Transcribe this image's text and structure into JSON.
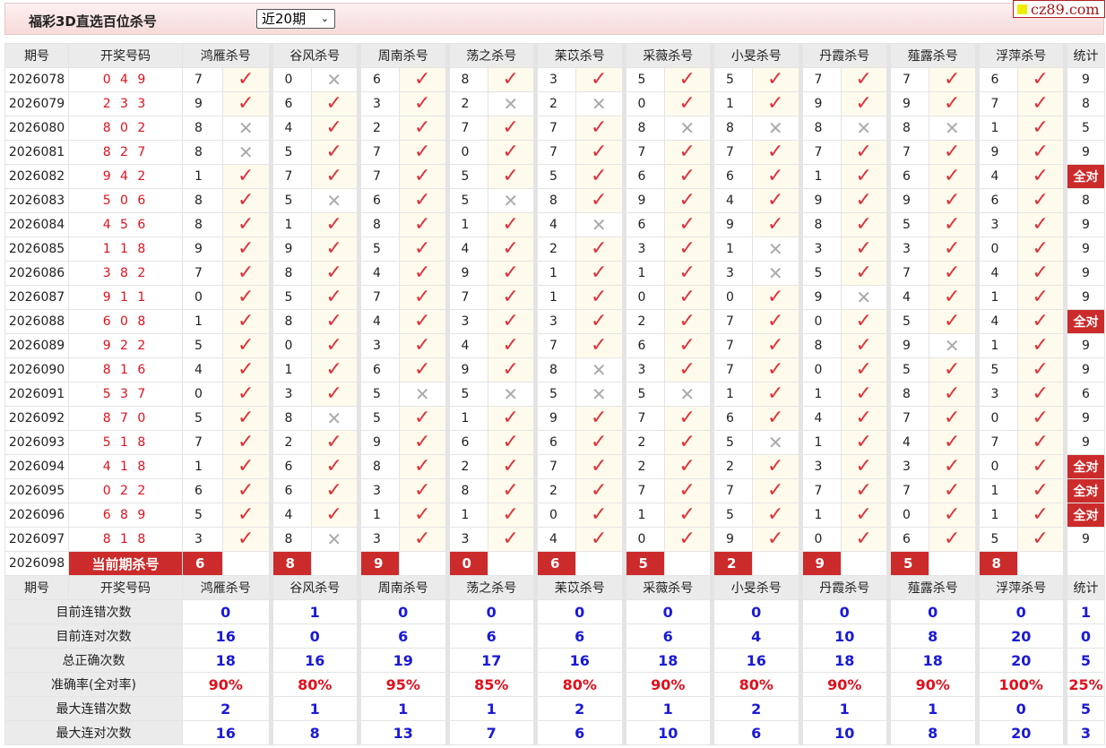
{
  "header": {
    "title": "福彩3D直选百位杀号",
    "period_select": "近20期",
    "logo": "cz89.com"
  },
  "columns": {
    "issue": "期号",
    "draw": "开奖号码",
    "stat": "统计",
    "predictors": [
      "鸿雁杀号",
      "谷风杀号",
      "周南杀号",
      "荡之杀号",
      "苿苡杀号",
      "采薇杀号",
      "小旻杀号",
      "丹霞杀号",
      "薤露杀号",
      "浮萍杀号"
    ]
  },
  "rows": [
    {
      "issue": "2026078",
      "draw": "0 4 9",
      "picks": [
        [
          7,
          1
        ],
        [
          0,
          0
        ],
        [
          6,
          1
        ],
        [
          8,
          1
        ],
        [
          3,
          1
        ],
        [
          5,
          1
        ],
        [
          5,
          1
        ],
        [
          7,
          1
        ],
        [
          7,
          1
        ],
        [
          6,
          1
        ]
      ],
      "stat": "9"
    },
    {
      "issue": "2026079",
      "draw": "2 3 3",
      "picks": [
        [
          9,
          1
        ],
        [
          6,
          1
        ],
        [
          3,
          1
        ],
        [
          2,
          0
        ],
        [
          2,
          0
        ],
        [
          0,
          1
        ],
        [
          1,
          1
        ],
        [
          9,
          1
        ],
        [
          9,
          1
        ],
        [
          7,
          1
        ]
      ],
      "stat": "8"
    },
    {
      "issue": "2026080",
      "draw": "8 0 2",
      "picks": [
        [
          8,
          0
        ],
        [
          4,
          1
        ],
        [
          2,
          1
        ],
        [
          7,
          1
        ],
        [
          7,
          1
        ],
        [
          8,
          0
        ],
        [
          8,
          0
        ],
        [
          8,
          0
        ],
        [
          8,
          0
        ],
        [
          1,
          1
        ]
      ],
      "stat": "5"
    },
    {
      "issue": "2026081",
      "draw": "8 2 7",
      "picks": [
        [
          8,
          0
        ],
        [
          5,
          1
        ],
        [
          7,
          1
        ],
        [
          0,
          1
        ],
        [
          7,
          1
        ],
        [
          7,
          1
        ],
        [
          7,
          1
        ],
        [
          7,
          1
        ],
        [
          7,
          1
        ],
        [
          9,
          1
        ]
      ],
      "stat": "9"
    },
    {
      "issue": "2026082",
      "draw": "9 4 2",
      "picks": [
        [
          1,
          1
        ],
        [
          7,
          1
        ],
        [
          7,
          1
        ],
        [
          5,
          1
        ],
        [
          5,
          1
        ],
        [
          6,
          1
        ],
        [
          6,
          1
        ],
        [
          1,
          1
        ],
        [
          6,
          1
        ],
        [
          4,
          1
        ]
      ],
      "stat": "全对"
    },
    {
      "issue": "2026083",
      "draw": "5 0 6",
      "picks": [
        [
          8,
          1
        ],
        [
          5,
          0
        ],
        [
          6,
          1
        ],
        [
          5,
          0
        ],
        [
          8,
          1
        ],
        [
          9,
          1
        ],
        [
          4,
          1
        ],
        [
          9,
          1
        ],
        [
          9,
          1
        ],
        [
          6,
          1
        ]
      ],
      "stat": "8"
    },
    {
      "issue": "2026084",
      "draw": "4 5 6",
      "picks": [
        [
          8,
          1
        ],
        [
          1,
          1
        ],
        [
          8,
          1
        ],
        [
          1,
          1
        ],
        [
          4,
          0
        ],
        [
          6,
          1
        ],
        [
          9,
          1
        ],
        [
          8,
          1
        ],
        [
          5,
          1
        ],
        [
          3,
          1
        ]
      ],
      "stat": "9"
    },
    {
      "issue": "2026085",
      "draw": "1 1 8",
      "picks": [
        [
          9,
          1
        ],
        [
          9,
          1
        ],
        [
          5,
          1
        ],
        [
          4,
          1
        ],
        [
          2,
          1
        ],
        [
          3,
          1
        ],
        [
          1,
          0
        ],
        [
          3,
          1
        ],
        [
          3,
          1
        ],
        [
          0,
          1
        ]
      ],
      "stat": "9"
    },
    {
      "issue": "2026086",
      "draw": "3 8 2",
      "picks": [
        [
          7,
          1
        ],
        [
          8,
          1
        ],
        [
          4,
          1
        ],
        [
          9,
          1
        ],
        [
          1,
          1
        ],
        [
          1,
          1
        ],
        [
          3,
          0
        ],
        [
          5,
          1
        ],
        [
          7,
          1
        ],
        [
          4,
          1
        ]
      ],
      "stat": "9"
    },
    {
      "issue": "2026087",
      "draw": "9 1 1",
      "picks": [
        [
          0,
          1
        ],
        [
          5,
          1
        ],
        [
          7,
          1
        ],
        [
          7,
          1
        ],
        [
          1,
          1
        ],
        [
          0,
          1
        ],
        [
          0,
          1
        ],
        [
          9,
          0
        ],
        [
          4,
          1
        ],
        [
          1,
          1
        ]
      ],
      "stat": "9"
    },
    {
      "issue": "2026088",
      "draw": "6 0 8",
      "picks": [
        [
          1,
          1
        ],
        [
          8,
          1
        ],
        [
          4,
          1
        ],
        [
          3,
          1
        ],
        [
          3,
          1
        ],
        [
          2,
          1
        ],
        [
          7,
          1
        ],
        [
          0,
          1
        ],
        [
          5,
          1
        ],
        [
          4,
          1
        ]
      ],
      "stat": "全对"
    },
    {
      "issue": "2026089",
      "draw": "9 2 2",
      "picks": [
        [
          5,
          1
        ],
        [
          0,
          1
        ],
        [
          3,
          1
        ],
        [
          4,
          1
        ],
        [
          7,
          1
        ],
        [
          6,
          1
        ],
        [
          7,
          1
        ],
        [
          8,
          1
        ],
        [
          9,
          0
        ],
        [
          1,
          1
        ]
      ],
      "stat": "9"
    },
    {
      "issue": "2026090",
      "draw": "8 1 6",
      "picks": [
        [
          4,
          1
        ],
        [
          1,
          1
        ],
        [
          6,
          1
        ],
        [
          9,
          1
        ],
        [
          8,
          0
        ],
        [
          3,
          1
        ],
        [
          7,
          1
        ],
        [
          0,
          1
        ],
        [
          5,
          1
        ],
        [
          5,
          1
        ]
      ],
      "stat": "9"
    },
    {
      "issue": "2026091",
      "draw": "5 3 7",
      "picks": [
        [
          0,
          1
        ],
        [
          3,
          1
        ],
        [
          5,
          0
        ],
        [
          5,
          0
        ],
        [
          5,
          0
        ],
        [
          5,
          0
        ],
        [
          1,
          1
        ],
        [
          1,
          1
        ],
        [
          8,
          1
        ],
        [
          3,
          1
        ]
      ],
      "stat": "6"
    },
    {
      "issue": "2026092",
      "draw": "8 7 0",
      "picks": [
        [
          5,
          1
        ],
        [
          8,
          0
        ],
        [
          5,
          1
        ],
        [
          1,
          1
        ],
        [
          9,
          1
        ],
        [
          7,
          1
        ],
        [
          6,
          1
        ],
        [
          4,
          1
        ],
        [
          7,
          1
        ],
        [
          0,
          1
        ]
      ],
      "stat": "9"
    },
    {
      "issue": "2026093",
      "draw": "5 1 8",
      "picks": [
        [
          7,
          1
        ],
        [
          2,
          1
        ],
        [
          9,
          1
        ],
        [
          6,
          1
        ],
        [
          6,
          1
        ],
        [
          2,
          1
        ],
        [
          5,
          0
        ],
        [
          1,
          1
        ],
        [
          4,
          1
        ],
        [
          7,
          1
        ]
      ],
      "stat": "9"
    },
    {
      "issue": "2026094",
      "draw": "4 1 8",
      "picks": [
        [
          1,
          1
        ],
        [
          6,
          1
        ],
        [
          8,
          1
        ],
        [
          2,
          1
        ],
        [
          7,
          1
        ],
        [
          2,
          1
        ],
        [
          2,
          1
        ],
        [
          3,
          1
        ],
        [
          3,
          1
        ],
        [
          0,
          1
        ]
      ],
      "stat": "全对"
    },
    {
      "issue": "2026095",
      "draw": "0 2 2",
      "picks": [
        [
          6,
          1
        ],
        [
          6,
          1
        ],
        [
          3,
          1
        ],
        [
          8,
          1
        ],
        [
          2,
          1
        ],
        [
          7,
          1
        ],
        [
          7,
          1
        ],
        [
          7,
          1
        ],
        [
          7,
          1
        ],
        [
          1,
          1
        ]
      ],
      "stat": "全对"
    },
    {
      "issue": "2026096",
      "draw": "6 8 9",
      "picks": [
        [
          5,
          1
        ],
        [
          4,
          1
        ],
        [
          1,
          1
        ],
        [
          1,
          1
        ],
        [
          0,
          1
        ],
        [
          1,
          1
        ],
        [
          5,
          1
        ],
        [
          1,
          1
        ],
        [
          0,
          1
        ],
        [
          1,
          1
        ]
      ],
      "stat": "全对"
    },
    {
      "issue": "2026097",
      "draw": "8 1 8",
      "picks": [
        [
          3,
          1
        ],
        [
          8,
          0
        ],
        [
          3,
          1
        ],
        [
          3,
          1
        ],
        [
          4,
          1
        ],
        [
          0,
          1
        ],
        [
          9,
          1
        ],
        [
          0,
          1
        ],
        [
          6,
          1
        ],
        [
          5,
          1
        ]
      ],
      "stat": "9"
    }
  ],
  "current": {
    "issue": "2026098",
    "label": "当前期杀号",
    "picks": [
      "6",
      "8",
      "9",
      "0",
      "6",
      "5",
      "2",
      "9",
      "5",
      "8"
    ]
  },
  "stats": [
    {
      "label": "目前连错次数",
      "values": [
        "0",
        "1",
        "0",
        "0",
        "0",
        "0",
        "0",
        "0",
        "0",
        "0"
      ],
      "stat": "1"
    },
    {
      "label": "目前连对次数",
      "values": [
        "16",
        "0",
        "6",
        "6",
        "6",
        "6",
        "4",
        "10",
        "8",
        "20"
      ],
      "stat": "0"
    },
    {
      "label": "总正确次数",
      "values": [
        "18",
        "16",
        "19",
        "17",
        "16",
        "18",
        "16",
        "18",
        "18",
        "20"
      ],
      "stat": "5"
    },
    {
      "label": "准确率(全对率)",
      "values": [
        "90%",
        "80%",
        "95%",
        "85%",
        "80%",
        "90%",
        "80%",
        "90%",
        "90%",
        "100%"
      ],
      "stat": "25%",
      "red": true
    },
    {
      "label": "最大连错次数",
      "values": [
        "2",
        "1",
        "1",
        "1",
        "2",
        "1",
        "2",
        "1",
        "1",
        "0"
      ],
      "stat": "5"
    },
    {
      "label": "最大连对次数",
      "values": [
        "16",
        "8",
        "13",
        "7",
        "6",
        "10",
        "6",
        "10",
        "8",
        "20"
      ],
      "stat": "3"
    }
  ],
  "icons": {
    "ok": "check-icon",
    "bad": "cross-icon"
  }
}
